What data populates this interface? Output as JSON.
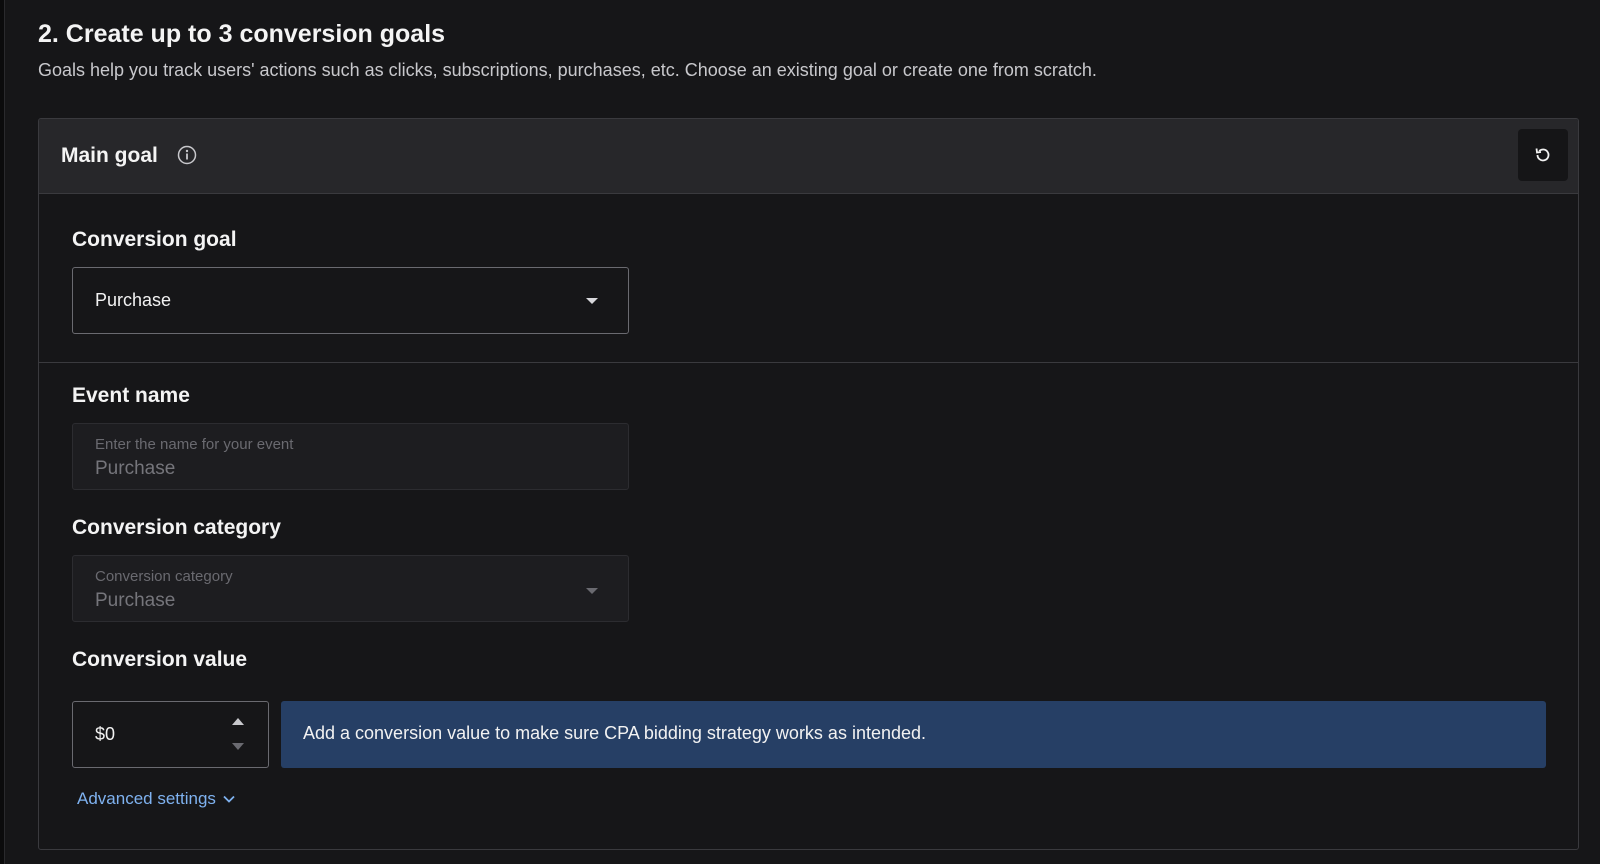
{
  "section": {
    "title": "2. Create up to 3 conversion goals",
    "description": "Goals help you track users' actions such as clicks, subscriptions, purchases, etc. Choose an existing goal or create one from scratch."
  },
  "card": {
    "title": "Main goal",
    "info_icon": "info-circle-icon",
    "reset_icon": "reset-icon"
  },
  "conversion_goal": {
    "label": "Conversion goal",
    "selected": "Purchase"
  },
  "event_name": {
    "label": "Event name",
    "placeholder": "Enter the name for your event",
    "value": "Purchase"
  },
  "conversion_category": {
    "label": "Conversion category",
    "float_label": "Conversion category",
    "value": "Purchase"
  },
  "conversion_value": {
    "label": "Conversion value",
    "value": "$0",
    "notice": "Add a conversion value to make sure CPA bidding strategy works as intended."
  },
  "advanced_settings": {
    "label": "Advanced settings"
  },
  "colors": {
    "background": "#161618",
    "header": "#27272a",
    "notice_bg": "#263f65",
    "link": "#7fb2f0"
  }
}
